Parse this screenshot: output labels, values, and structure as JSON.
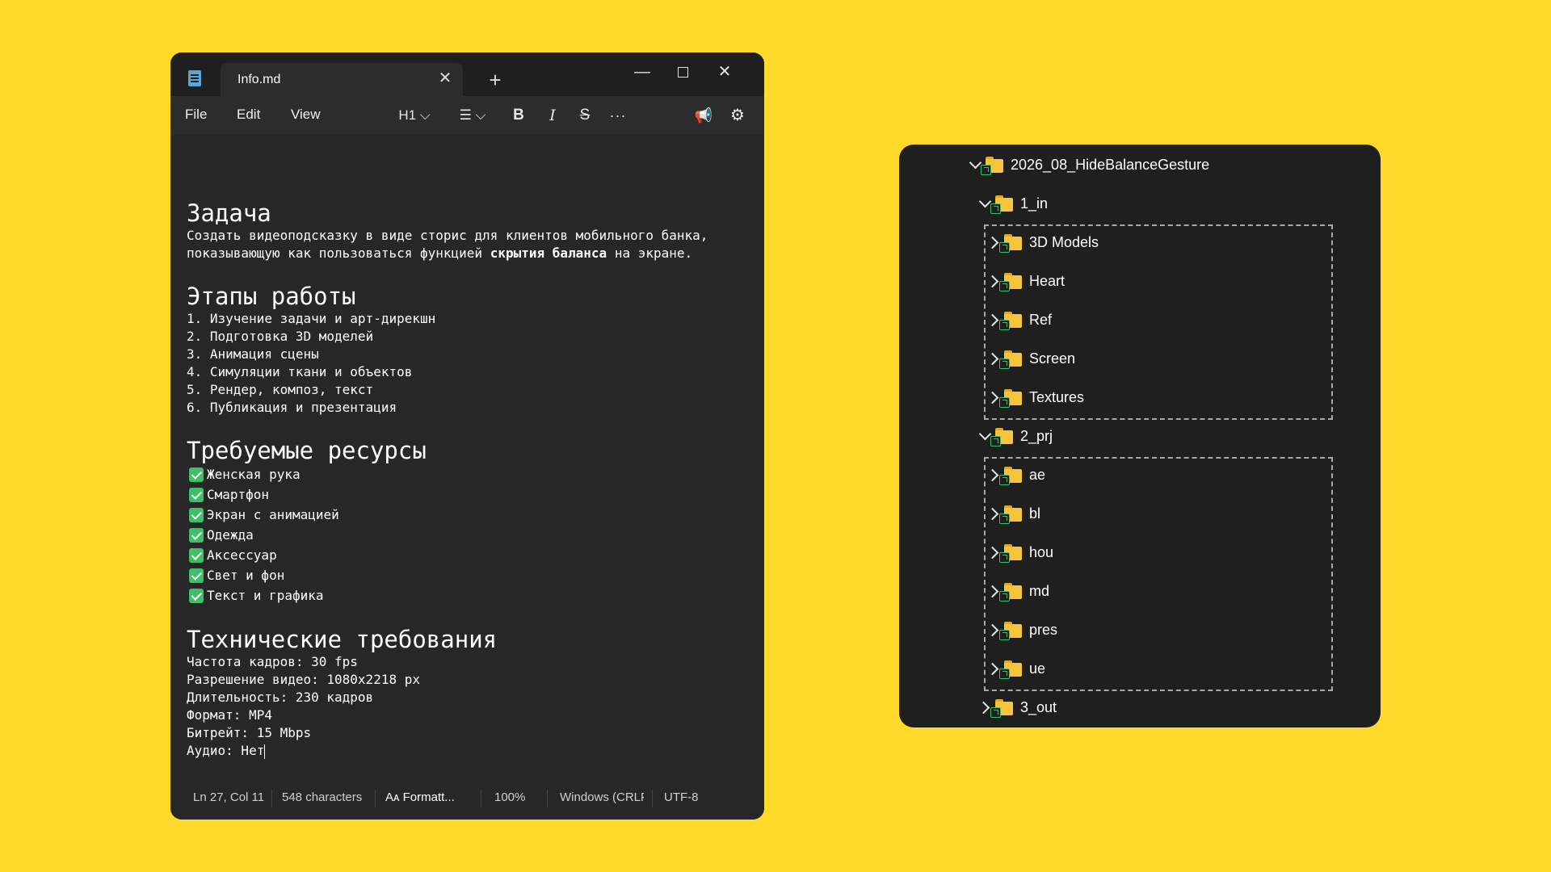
{
  "notepad": {
    "tab_title": "Info.md",
    "menu": {
      "file": "File",
      "edit": "Edit",
      "view": "View"
    },
    "toolbar": {
      "heading": "H1 ⌵",
      "list": "☰ ⌵",
      "bold": "B",
      "italic": "I",
      "strike": "S",
      "more": "···"
    },
    "content": {
      "h_task": "Задача",
      "task_text_1": "Создать видеоподсказку в виде сторис для клиентов мобильного банка,",
      "task_text_2a": "показывающую как пользоваться функцией ",
      "task_text_2b": "скрытия баланса",
      "task_text_2c": " на экране.",
      "h_stages": "Этапы работы",
      "stages": [
        "1. Изучение задачи и арт-дирекшн",
        "2. Подготовка 3D моделей",
        "3. Анимация сцены",
        "4. Симуляции ткани и объектов",
        "5. Рендер, композ, текст",
        "6. Публикация и презентация"
      ],
      "h_resources": "Требуемые ресурсы",
      "resources": [
        "Женская рука",
        "Смартфон",
        "Экран с анимацией",
        "Одежда",
        "Аксессуар",
        "Свет и фон",
        "Текст и графика"
      ],
      "h_tech": "Технические требования",
      "tech": [
        "Частота кадров: 30 fps",
        "Разрешение видео: 1080x2218 px",
        "Длительность: 230 кадров",
        "Формат: MP4",
        "Битрейт: 15 Mbps",
        "Аудио: Нет"
      ]
    },
    "status": {
      "position": "Ln 27, Col 11",
      "characters": "548 characters",
      "formatting": "Formatt...",
      "zoom": "100%",
      "line_ending": "Windows (CRLF)",
      "encoding": "UTF-8"
    }
  },
  "tree": {
    "root": "2026_08_HideBalanceGesture",
    "in_folder": "1_in",
    "in_children": [
      "3D Models",
      "Heart",
      "Ref",
      "Screen",
      "Textures"
    ],
    "prj_folder": "2_prj",
    "prj_children": [
      "ae",
      "bl",
      "hou",
      "md",
      "pres",
      "ue"
    ],
    "out_folder": "3_out"
  },
  "colors": {
    "background": "#FFDA2A",
    "folder": "#F8C53A",
    "check": "#3FBF6A"
  }
}
